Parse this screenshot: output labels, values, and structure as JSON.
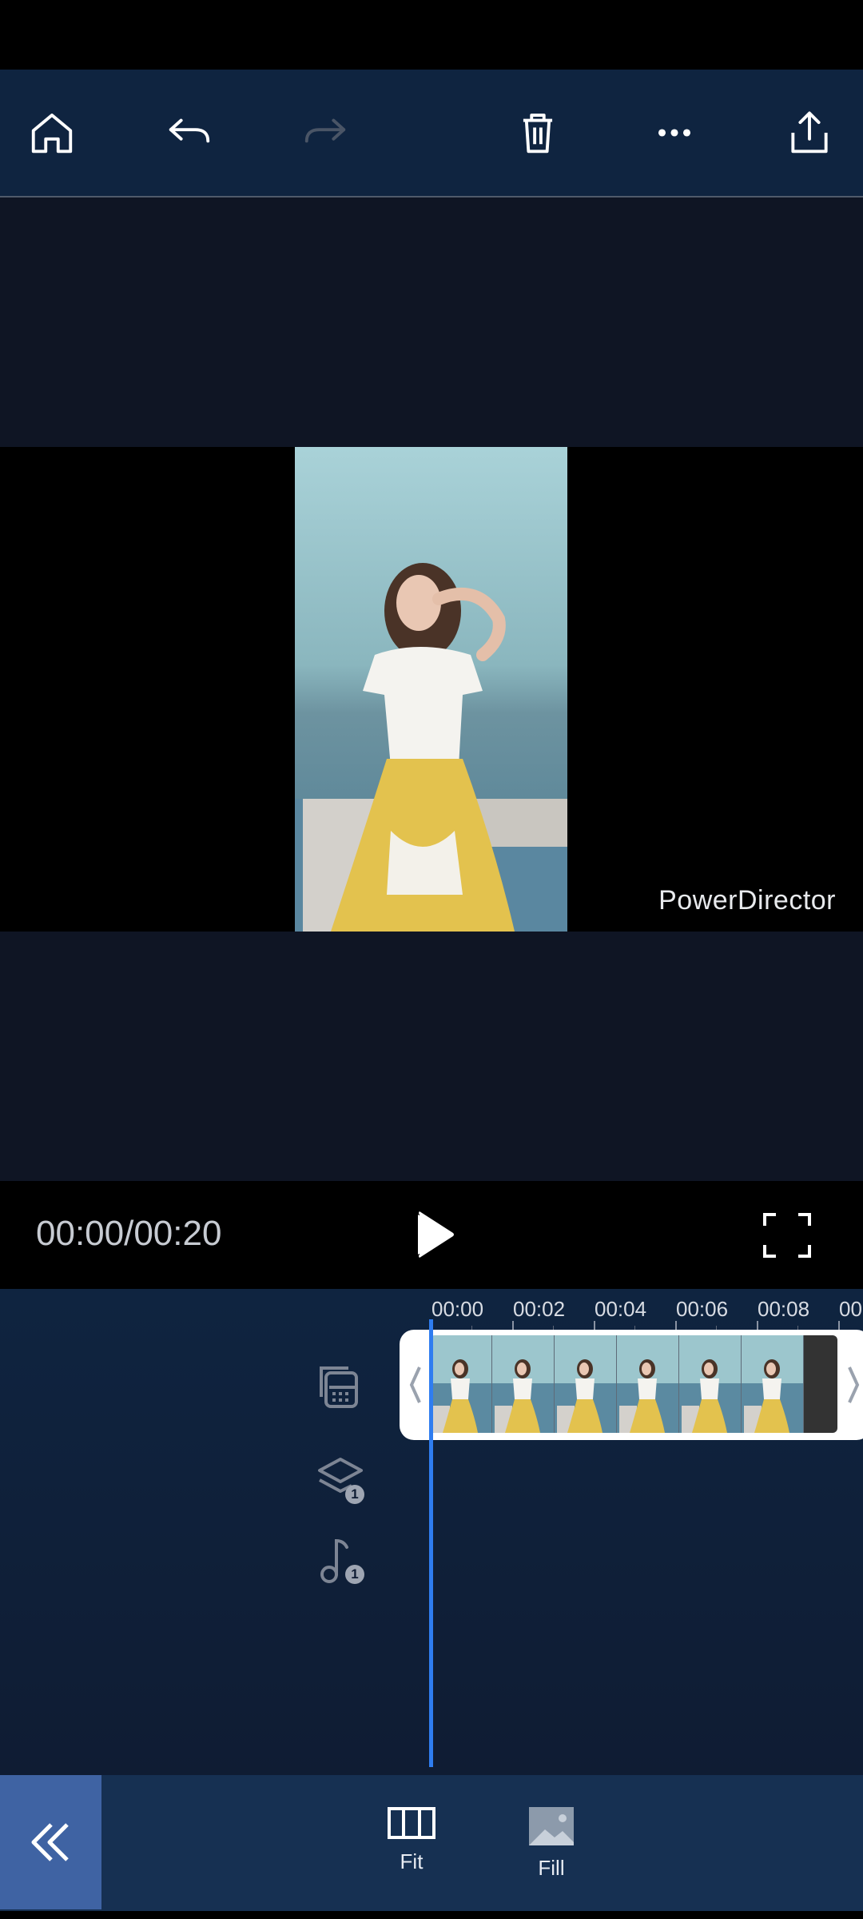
{
  "toolbar": {
    "home_icon": "home-icon",
    "undo_icon": "undo-icon",
    "redo_icon": "redo-icon",
    "delete_icon": "trash-icon",
    "more_icon": "more-horizontal-icon",
    "export_icon": "share-export-icon"
  },
  "preview": {
    "watermark": "PowerDirector"
  },
  "playback": {
    "timecode": "00:00/00:20",
    "play_icon": "play-icon",
    "fullscreen_icon": "fullscreen-icon"
  },
  "timeline": {
    "ruler": [
      "00:00",
      "00:02",
      "00:04",
      "00:06",
      "00:08",
      "00"
    ],
    "tracks": [
      {
        "icon": "video-track-icon",
        "badge": ""
      },
      {
        "icon": "layers-icon",
        "badge": "1"
      },
      {
        "icon": "music-note-icon",
        "badge": "1"
      }
    ]
  },
  "bottom_bar": {
    "back_icon": "double-chevron-left-icon",
    "items": [
      {
        "label": "Fit",
        "icon": "fit-icon"
      },
      {
        "label": "Fill",
        "icon": "fill-icon"
      }
    ]
  },
  "colors": {
    "accent": "#2f7df0",
    "toolbar_bg": "#0f2440",
    "back_button_bg": "#3f63a3"
  }
}
